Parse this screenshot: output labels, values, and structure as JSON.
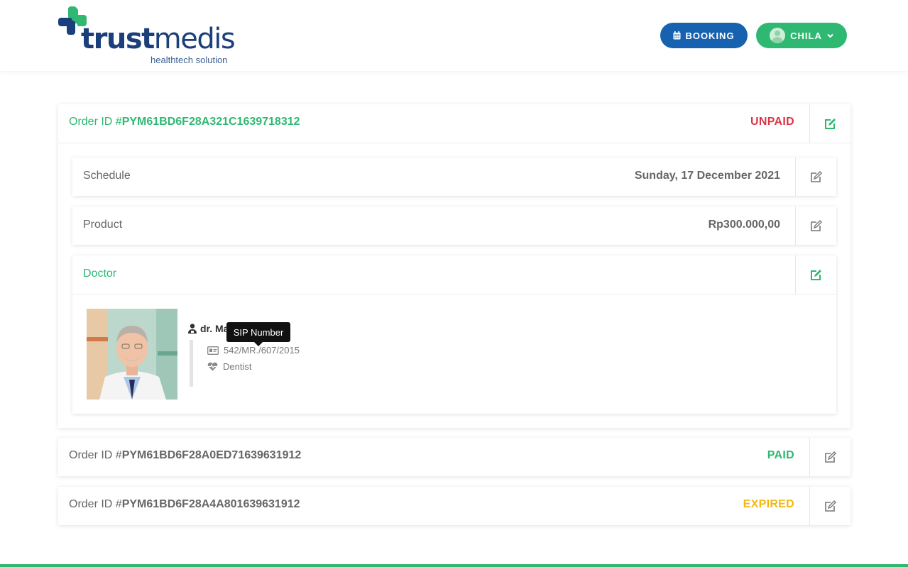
{
  "brand": {
    "name_bold": "trust",
    "name_regular": "medis",
    "tagline": "healthtech solution",
    "green": "#2eb872",
    "blue": "#1b3f7a"
  },
  "header": {
    "booking_label": "BOOKING",
    "booking_icon": "calendar-icon",
    "user_name": "CHILA",
    "user_icon": "avatar-icon",
    "dropdown_icon": "chevron-down-icon"
  },
  "orders": [
    {
      "id_prefix": "Order ID #",
      "id_value": "PYM61BD6F28A321C1639718312",
      "status": "UNPAID",
      "status_color": "#dc3545",
      "expanded": true,
      "details": {
        "schedule_label": "Schedule",
        "schedule_value": "Sunday, 17 December 2021",
        "product_label": "Product",
        "product_value": "Rp300.000,00",
        "doctor_label": "Doctor",
        "doctor_name": "dr. Matthias Adams",
        "sip_number": "542/MR./607/2015",
        "specialty": "Dentist",
        "tooltip": "SIP Number"
      }
    },
    {
      "id_prefix": "Order ID #",
      "id_value": "PYM61BD6F28A0ED71639631912",
      "status": "PAID",
      "status_color": "#2eb872",
      "expanded": false
    },
    {
      "id_prefix": "Order ID #",
      "id_value": "PYM61BD6F28A4A801639631912",
      "status": "EXPIRED",
      "status_color": "#f5b80f",
      "expanded": false
    }
  ]
}
